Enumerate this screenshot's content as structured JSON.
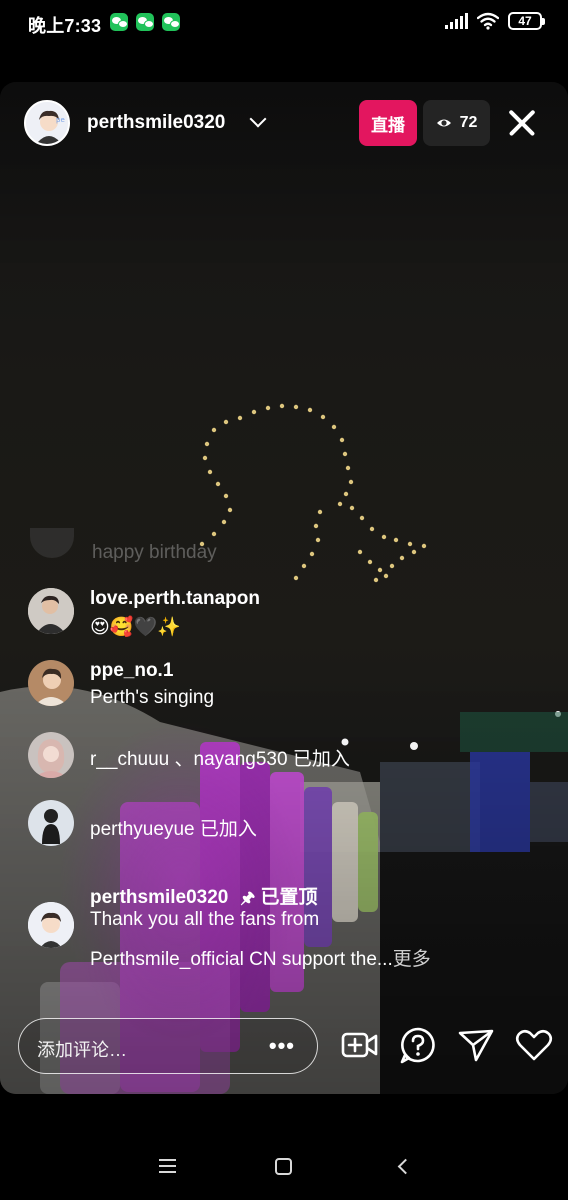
{
  "status_bar": {
    "time": "晚上7:33",
    "notification_icons": [
      "wechat-icon",
      "wechat-icon",
      "wechat-icon"
    ],
    "battery": "47"
  },
  "live": {
    "host_name": "perthsmile0320",
    "live_label": "直播",
    "viewer_count": "72",
    "accent_color": "#e3165f"
  },
  "comments": {
    "faded": {
      "text": "happy birthday"
    },
    "items": [
      {
        "user": "love.perth.tanapon",
        "text": "😍🥰🖤✨"
      },
      {
        "user": "ppe_no.1",
        "text": "Perth's singing"
      }
    ],
    "joins": [
      {
        "text": "r__chuuu 、nayang530 已加入"
      },
      {
        "text": "perthyueyue 已加入"
      }
    ],
    "pinned": {
      "user": "perthsmile0320",
      "pin_label": "已置顶",
      "line1": "Thank you all the fans from",
      "line2": "Perthsmile_official CN support the...",
      "more": "更多"
    }
  },
  "bottom_bar": {
    "comment_placeholder": "添加评论…",
    "more_dots": "•••"
  }
}
